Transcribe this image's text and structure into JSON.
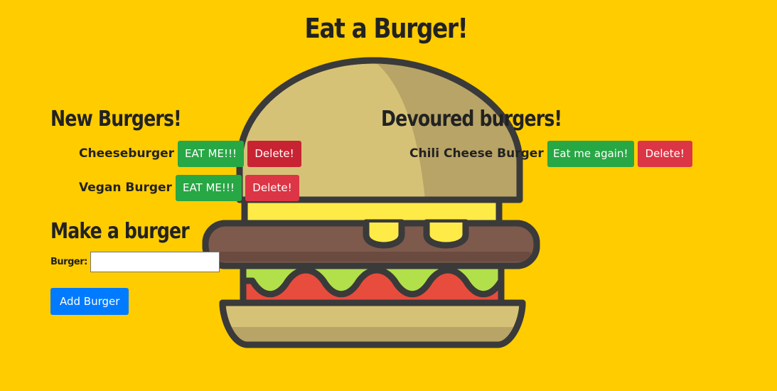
{
  "page": {
    "title": "Eat a Burger!"
  },
  "new_burgers": {
    "heading": "New Burgers!",
    "items": [
      {
        "name": "Cheeseburger",
        "eat_label": "EAT ME!!!",
        "delete_label": "Delete!"
      },
      {
        "name": "Vegan Burger",
        "eat_label": "EAT ME!!!",
        "delete_label": "Delete!"
      }
    ]
  },
  "devoured_burgers": {
    "heading": "Devoured burgers!",
    "items": [
      {
        "name": "Chili Cheese Burger",
        "eat_again_label": "Eat me again!",
        "delete_label": "Delete!"
      }
    ]
  },
  "make_burger": {
    "heading": "Make a burger",
    "field_label": "Burger:",
    "field_value": "",
    "submit_label": "Add Burger"
  },
  "colors": {
    "background": "#ffcc00",
    "eat_button": "#28a745",
    "delete_button": "#dc3545",
    "add_button": "#007bff"
  },
  "icons": {
    "background_illustration": "burger-illustration"
  }
}
